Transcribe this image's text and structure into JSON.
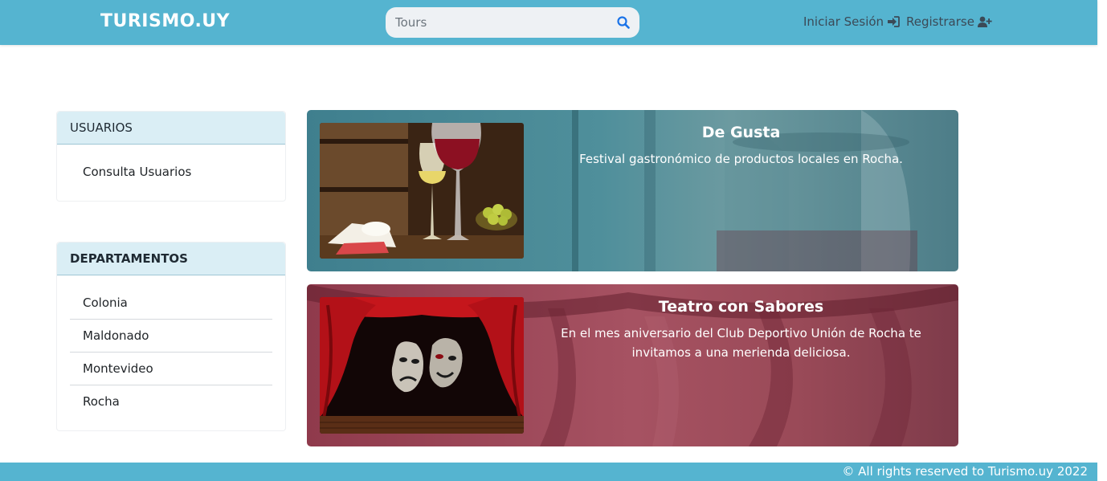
{
  "header": {
    "brand": "TURISMO.UY",
    "search": {
      "placeholder": "Tours",
      "value": ""
    },
    "login_label": "Iniciar Sesión",
    "register_label": "Registrarse"
  },
  "sidebar": {
    "users": {
      "title": "USUARIOS",
      "items": [
        {
          "label": "Consulta Usuarios"
        }
      ]
    },
    "departments": {
      "title": "DEPARTAMENTOS",
      "items": [
        {
          "label": "Colonia"
        },
        {
          "label": "Maldonado"
        },
        {
          "label": "Montevideo"
        },
        {
          "label": "Rocha"
        }
      ]
    }
  },
  "events": [
    {
      "title": "De Gusta",
      "description": "Festival gastronómico de productos locales en Rocha.",
      "image_icon": "wine-cheese-image"
    },
    {
      "title": "Teatro con Sabores",
      "description": "En el mes aniversario del Club Deportivo Unión de Rocha te invitamos a una merienda deliciosa.",
      "image_icon": "theater-masks-image"
    }
  ],
  "footer": {
    "text": "© All rights reserved to Turismo.uy 2022"
  },
  "colors": {
    "primary": "#55b4d0",
    "sidebar_header": "#daeef5"
  }
}
